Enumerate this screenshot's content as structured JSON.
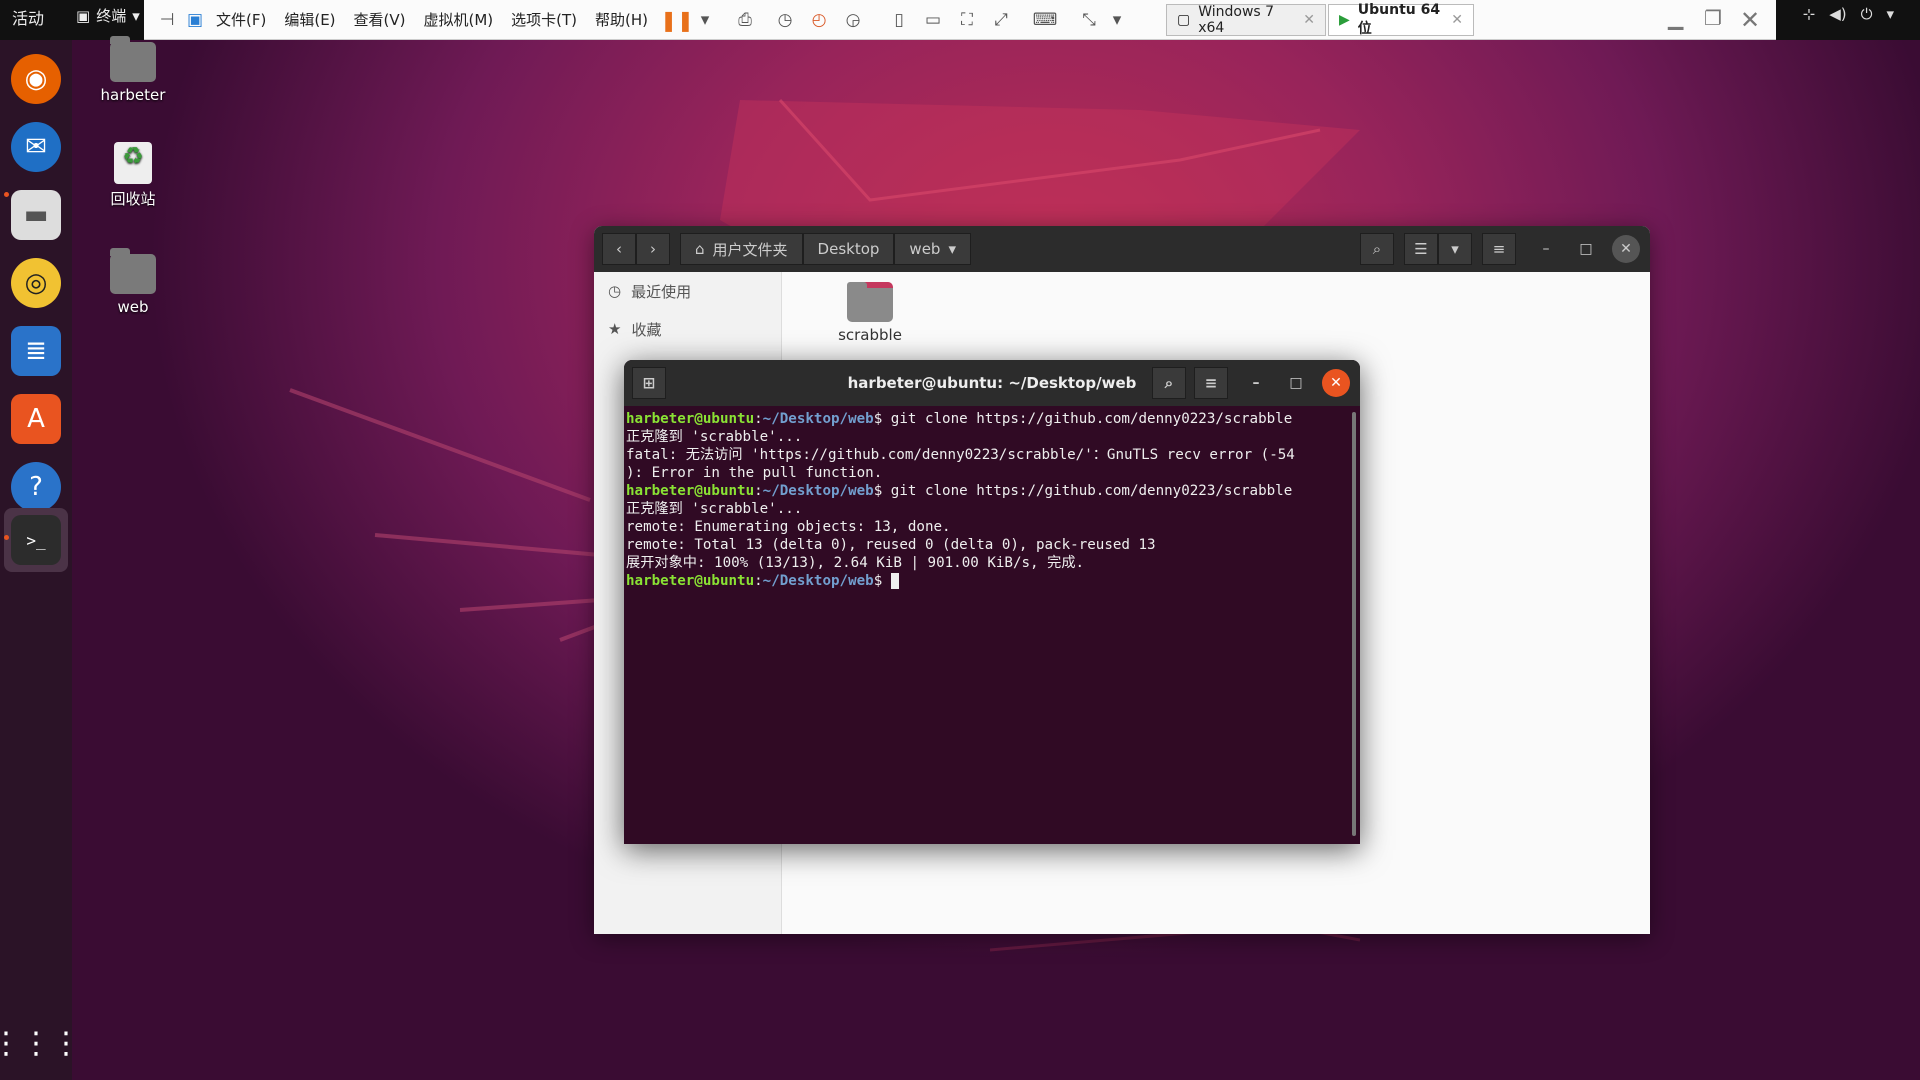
{
  "topbar": {
    "activities": "活动",
    "app_name": "终端"
  },
  "vmbar": {
    "menu": [
      "文件(F)",
      "编辑(E)",
      "查看(V)",
      "虚拟机(M)",
      "选项卡(T)",
      "帮助(H)"
    ],
    "tabs": [
      {
        "label": "Windows 7 x64"
      },
      {
        "label": "Ubuntu 64 位"
      }
    ]
  },
  "desktop": {
    "icons": [
      {
        "label": "harbeter"
      },
      {
        "label": "回收站"
      },
      {
        "label": "web"
      }
    ]
  },
  "files": {
    "breadcrumbs": [
      "用户文件夹",
      "Desktop",
      "web"
    ],
    "sidebar": [
      {
        "label": "最近使用",
        "icon": "clock-icon"
      },
      {
        "label": "收藏",
        "icon": "star-icon"
      }
    ],
    "items": [
      {
        "label": "scrabble"
      }
    ]
  },
  "terminal": {
    "title": "harbeter@ubuntu: ~/Desktop/web",
    "prompt_user": "harbeter@ubuntu",
    "prompt_path": "~/Desktop/web",
    "cmd1": "$ git clone https://github.com/denny0223/scrabble",
    "l1": "正克隆到 'scrabble'...",
    "l2": "fatal: 无法访问 'https://github.com/denny0223/scrabble/'：GnuTLS recv error (-54",
    "l3": "): Error in the pull function.",
    "cmd2": "$ git clone https://github.com/denny0223/scrabble",
    "l4": "正克隆到 'scrabble'...",
    "l5": "remote: Enumerating objects: 13, done.",
    "l6": "remote: Total 13 (delta 0), reused 0 (delta 0), pack-reused 13",
    "l7": "展开对象中: 100% (13/13), 2.64 KiB | 901.00 KiB/s, 完成.",
    "end": "$ "
  }
}
